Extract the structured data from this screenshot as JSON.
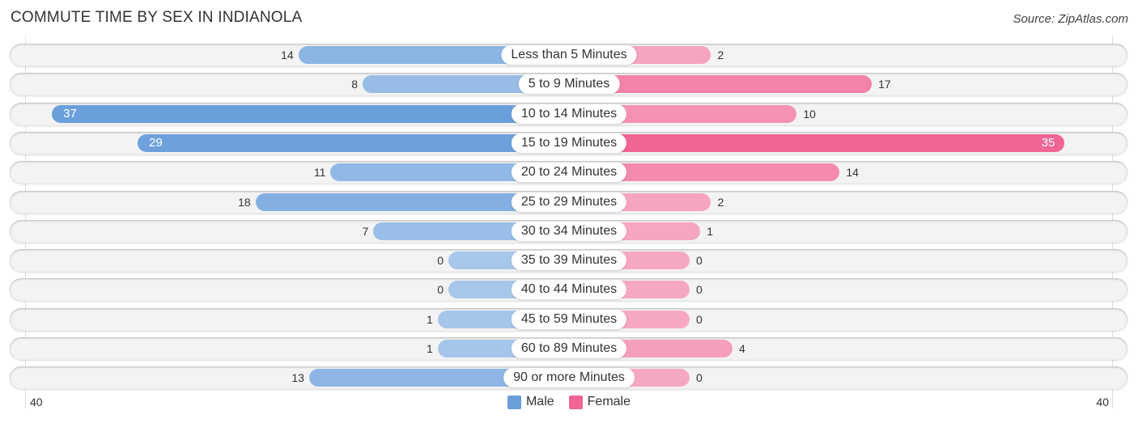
{
  "chart_data": {
    "type": "bar",
    "orientation": "horizontal-diverging",
    "title": "COMMUTE TIME BY SEX IN INDIANOLA",
    "source": "Source: ZipAtlas.com",
    "categories": [
      "Less than 5 Minutes",
      "5 to 9 Minutes",
      "10 to 14 Minutes",
      "15 to 19 Minutes",
      "20 to 24 Minutes",
      "25 to 29 Minutes",
      "30 to 34 Minutes",
      "35 to 39 Minutes",
      "40 to 44 Minutes",
      "45 to 59 Minutes",
      "60 to 89 Minutes",
      "90 or more Minutes"
    ],
    "series": [
      {
        "name": "Male",
        "color": "#6a9fdb",
        "light_color": "#a7c7ea",
        "values": [
          14,
          8,
          37,
          29,
          11,
          18,
          7,
          0,
          0,
          1,
          1,
          13
        ]
      },
      {
        "name": "Female",
        "color": "#f06593",
        "light_color": "#f7a8c1",
        "values": [
          2,
          17,
          10,
          35,
          14,
          2,
          1,
          0,
          0,
          0,
          4,
          0
        ]
      }
    ],
    "xlim": [
      40,
      40
    ],
    "axis_labels": {
      "left": "40",
      "right": "40"
    },
    "legend": {
      "position": "bottom-center",
      "items": [
        "Male",
        "Female"
      ]
    }
  }
}
